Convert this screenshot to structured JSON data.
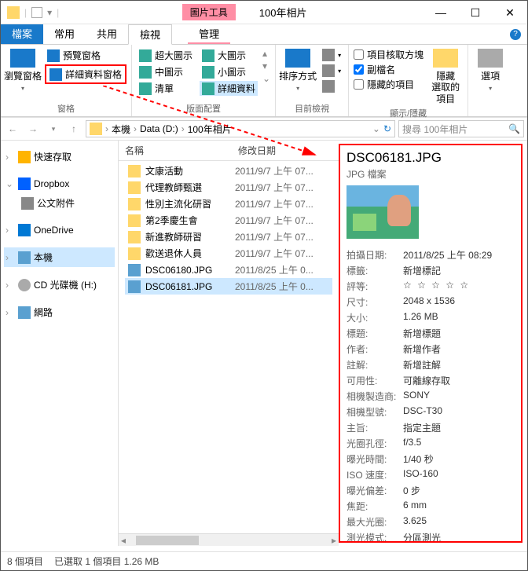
{
  "window": {
    "title": "100年相片",
    "context_tab": "圖片工具"
  },
  "tabs": {
    "file": "檔案",
    "home": "常用",
    "share": "共用",
    "view": "檢視",
    "manage": "管理"
  },
  "ribbon": {
    "nav_pane": "瀏覽窗格",
    "preview_pane": "預覽窗格",
    "details_pane": "詳細資料窗格",
    "panes_label": "窗格",
    "extra_large": "超大圖示",
    "large": "大圖示",
    "medium": "中圖示",
    "small": "小圖示",
    "list": "清單",
    "details": "詳細資料",
    "layout_label": "版面配置",
    "sort": "排序方式",
    "current_view_label": "目前檢視",
    "checkboxes": "項目核取方塊",
    "extensions": "副檔名",
    "hidden_items": "隱藏的項目",
    "hide_selected": "隱藏\n選取的項目",
    "show_hide_label": "顯示/隱藏",
    "options": "選項"
  },
  "breadcrumb": {
    "pc": "本機",
    "drive": "Data (D:)",
    "folder": "100年相片"
  },
  "search": {
    "placeholder": "搜尋 100年相片"
  },
  "nav": {
    "quick": "快速存取",
    "dropbox": "Dropbox",
    "attachments": "公文附件",
    "onedrive": "OneDrive",
    "pc": "本機",
    "cd": "CD 光碟機 (H:)",
    "network": "網路"
  },
  "columns": {
    "name": "名稱",
    "modified": "修改日期"
  },
  "files": [
    {
      "name": "文康活動",
      "date": "2011/9/7 上午 07...",
      "type": "folder"
    },
    {
      "name": "代理教師甄選",
      "date": "2011/9/7 上午 07...",
      "type": "folder"
    },
    {
      "name": "性別主流化研習",
      "date": "2011/9/7 上午 07...",
      "type": "folder"
    },
    {
      "name": "第2季慶生會",
      "date": "2011/9/7 上午 07...",
      "type": "folder"
    },
    {
      "name": "新進教師研習",
      "date": "2011/9/7 上午 07...",
      "type": "folder"
    },
    {
      "name": "歡送退休人員",
      "date": "2011/9/7 上午 07...",
      "type": "folder"
    },
    {
      "name": "DSC06180.JPG",
      "date": "2011/8/25 上午 0...",
      "type": "image"
    },
    {
      "name": "DSC06181.JPG",
      "date": "2011/8/25 上午 0...",
      "type": "image",
      "selected": true
    }
  ],
  "details": {
    "name": "DSC06181.JPG",
    "type": "JPG 檔案",
    "props": [
      {
        "k": "拍攝日期:",
        "v": "2011/8/25 上午 08:29"
      },
      {
        "k": "標籤:",
        "v": "新增標記"
      },
      {
        "k": "評等:",
        "v": "☆ ☆ ☆ ☆ ☆",
        "stars": true
      },
      {
        "k": "尺寸:",
        "v": "2048 x 1536"
      },
      {
        "k": "大小:",
        "v": "1.26 MB"
      },
      {
        "k": "標題:",
        "v": "新增標題"
      },
      {
        "k": "作者:",
        "v": "新增作者"
      },
      {
        "k": "註解:",
        "v": "新增註解"
      },
      {
        "k": "可用性:",
        "v": "可離線存取"
      },
      {
        "k": "相機製造商:",
        "v": "SONY"
      },
      {
        "k": "相機型號:",
        "v": "DSC-T30"
      },
      {
        "k": "主旨:",
        "v": "指定主題"
      },
      {
        "k": "光圈孔徑:",
        "v": "f/3.5"
      },
      {
        "k": "曝光時間:",
        "v": "1/40 秒"
      },
      {
        "k": "ISO 速度:",
        "v": "ISO-160"
      },
      {
        "k": "曝光偏差:",
        "v": "0 步"
      },
      {
        "k": "焦距:",
        "v": "6 mm"
      },
      {
        "k": "最大光圈:",
        "v": "3.625"
      },
      {
        "k": "測光模式:",
        "v": "分區測光"
      }
    ]
  },
  "status": {
    "count": "8 個項目",
    "selection": "已選取 1 個項目  1.26 MB"
  }
}
